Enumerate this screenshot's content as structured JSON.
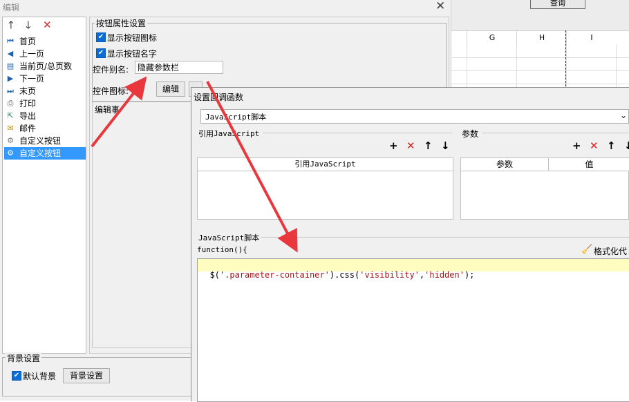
{
  "background": {
    "query_button": "查询",
    "columns": [
      "G",
      "H",
      "I"
    ]
  },
  "editor": {
    "title": "编辑",
    "close": "✕",
    "items": [
      {
        "label": "首页",
        "icon": "first-page-icon"
      },
      {
        "label": "上一页",
        "icon": "prev-page-icon"
      },
      {
        "label": "当前页/总页数",
        "icon": "page-count-icon"
      },
      {
        "label": "下一页",
        "icon": "next-page-icon"
      },
      {
        "label": "末页",
        "icon": "last-page-icon"
      },
      {
        "label": "打印",
        "icon": "print-icon"
      },
      {
        "label": "导出",
        "icon": "export-icon"
      },
      {
        "label": "邮件",
        "icon": "mail-icon"
      },
      {
        "label": "自定义按钮",
        "icon": "gear-icon"
      },
      {
        "label": "自定义按钮",
        "icon": "gear-icon"
      }
    ],
    "props": {
      "group_title": "按钮属性设置",
      "show_icon": "显示按钮图标",
      "show_name": "显示按钮名字",
      "alias_label": "控件别名:",
      "alias_value": "隐藏参数栏",
      "icon_label": "控件图标:",
      "edit_button": "编辑",
      "edit_event_label": "编辑事"
    },
    "bg_settings": {
      "group_title": "背景设置",
      "default_bg": "默认背景",
      "button": "背景设置"
    }
  },
  "dialog": {
    "title": "设置回调函数",
    "script_type": "JavaScript脚本",
    "ref_js_title": "引用JavaScript",
    "ref_js_column": "引用JavaScript",
    "params_title": "参数",
    "params_columns": [
      "参数",
      "值"
    ],
    "js_section_title": "JavaScript脚本",
    "function_header": "function(){",
    "format_button": "格式化代",
    "code": [
      {
        "text": "$(",
        "color": "#000000"
      },
      {
        "text": "'.parameter-container'",
        "color": "#a31515"
      },
      {
        "text": ").css(",
        "color": "#000000"
      },
      {
        "text": "'visibility'",
        "color": "#a31515"
      },
      {
        "text": ",",
        "color": "#000000"
      },
      {
        "text": "'hidden'",
        "color": "#a31515"
      },
      {
        "text": ");",
        "color": "#000000"
      }
    ]
  },
  "colors": {
    "arrow": "#e8383d",
    "selection": "#3399ff",
    "delete": "#e02020"
  }
}
